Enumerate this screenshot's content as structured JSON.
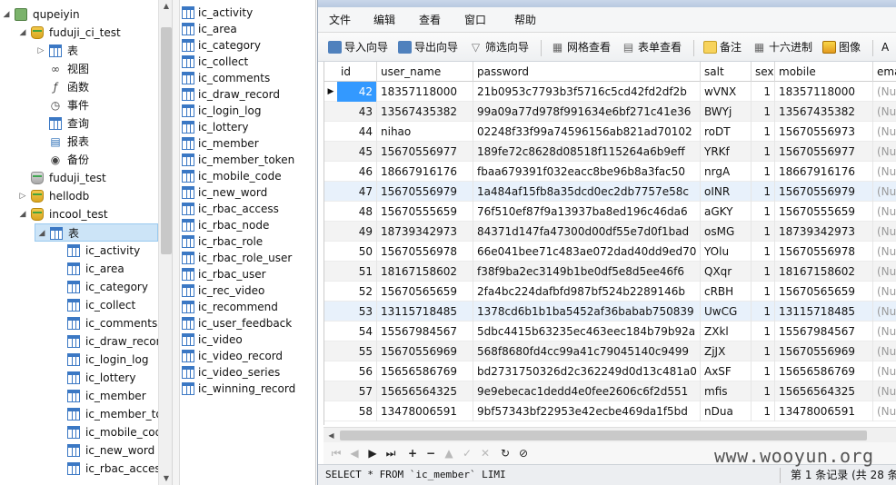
{
  "tree": {
    "connection": "qupeiyin",
    "db1": {
      "name": "fuduji_ci_test",
      "children": [
        "表",
        "视图",
        "函数",
        "事件",
        "查询",
        "报表",
        "备份"
      ]
    },
    "db2": "fuduji_test",
    "db3": "hellodb",
    "db4": "incool_test",
    "db4_tables_label": "表",
    "db4_tables": [
      "ic_activity",
      "ic_area",
      "ic_category",
      "ic_collect",
      "ic_comments",
      "ic_draw_recor",
      "ic_login_log",
      "ic_lottery",
      "ic_member",
      "ic_member_to",
      "ic_mobile_cod",
      "ic_new_word",
      "ic_rbac_acces"
    ]
  },
  "table_list": [
    "ic_activity",
    "ic_area",
    "ic_category",
    "ic_collect",
    "ic_comments",
    "ic_draw_record",
    "ic_login_log",
    "ic_lottery",
    "ic_member",
    "ic_member_token",
    "ic_mobile_code",
    "ic_new_word",
    "ic_rbac_access",
    "ic_rbac_node",
    "ic_rbac_role",
    "ic_rbac_role_user",
    "ic_rbac_user",
    "ic_rec_video",
    "ic_recommend",
    "ic_user_feedback",
    "ic_video",
    "ic_video_record",
    "ic_video_series",
    "ic_winning_record"
  ],
  "menu": [
    "文件",
    "编辑",
    "查看",
    "窗口",
    "帮助"
  ],
  "toolbar": [
    "导入向导",
    "导出向导",
    "筛选向导",
    "网格查看",
    "表单查看",
    "备注",
    "十六进制",
    "图像",
    "A"
  ],
  "grid": {
    "columns": [
      "id",
      "user_name",
      "password",
      "salt",
      "sex",
      "mobile",
      "ema"
    ],
    "null_text": "(Nul",
    "rows": [
      [
        "42",
        "18357118000",
        "21b0953c7793b3f5716c5cd42fd2df2b",
        "wVNX",
        "1",
        "18357118000"
      ],
      [
        "43",
        "13567435382",
        "99a09a77d978f991634e6bf271c41e36",
        "BWYj",
        "1",
        "13567435382"
      ],
      [
        "44",
        "nihao",
        "02248f33f99a74596156ab821ad70102",
        "roDT",
        "1",
        "15670556973"
      ],
      [
        "45",
        "15670556977",
        "189fe72c8628d08518f115264a6b9eff",
        "YRKf",
        "1",
        "15670556977"
      ],
      [
        "46",
        "18667916176",
        "fbaa679391f032eacc8be96b8a3fac50",
        "nrgA",
        "1",
        "18667916176"
      ],
      [
        "47",
        "15670556979",
        "1a484af15fb8a35dcd0ec2db7757e58c",
        "oINR",
        "1",
        "15670556979"
      ],
      [
        "48",
        "15670555659",
        "76f510ef87f9a13937ba8ed196c46da6",
        "aGKY",
        "1",
        "15670555659"
      ],
      [
        "49",
        "18739342973",
        "84371d147fa47300d00df55e7d0f1bad",
        "osMG",
        "1",
        "18739342973"
      ],
      [
        "50",
        "15670556978",
        "66e041bee71c483ae072dad40dd9ed70",
        "YOlu",
        "1",
        "15670556978"
      ],
      [
        "51",
        "18167158602",
        "f38f9ba2ec3149b1be0df5e8d5ee46f6",
        "QXqr",
        "1",
        "18167158602"
      ],
      [
        "52",
        "15670565659",
        "2fa4bc224dafbfd987bf524b2289146b",
        "cRBH",
        "1",
        "15670565659"
      ],
      [
        "53",
        "13115718485",
        "1378cd6b1b1ba5452af36babab750839",
        "UwCG",
        "1",
        "13115718485"
      ],
      [
        "54",
        "15567984567",
        "5dbc4415b63235ec463eec184b79b92a",
        "ZXkl",
        "1",
        "15567984567"
      ],
      [
        "55",
        "15670556969",
        "568f8680fd4cc99a41c79045140c9499",
        "ZjJX",
        "1",
        "15670556969"
      ],
      [
        "56",
        "15656586769",
        "bd2731750326d2c362249d0d13c481a0",
        "AxSF",
        "1",
        "15656586769"
      ],
      [
        "57",
        "15656564325",
        "9e9ebecac1dedd4e0fee2606c6f2d551",
        "mfis",
        "1",
        "15656564325"
      ],
      [
        "58",
        "13478006591",
        "9bf57343bf22953e42ecbe469da1f5bd",
        "nDua",
        "1",
        "13478006591"
      ]
    ]
  },
  "status": {
    "sql": "SELECT * FROM `ic_member` LIMI",
    "record": "第 1 条记录 (共 28 条"
  },
  "watermark": "www.wooyun.org"
}
